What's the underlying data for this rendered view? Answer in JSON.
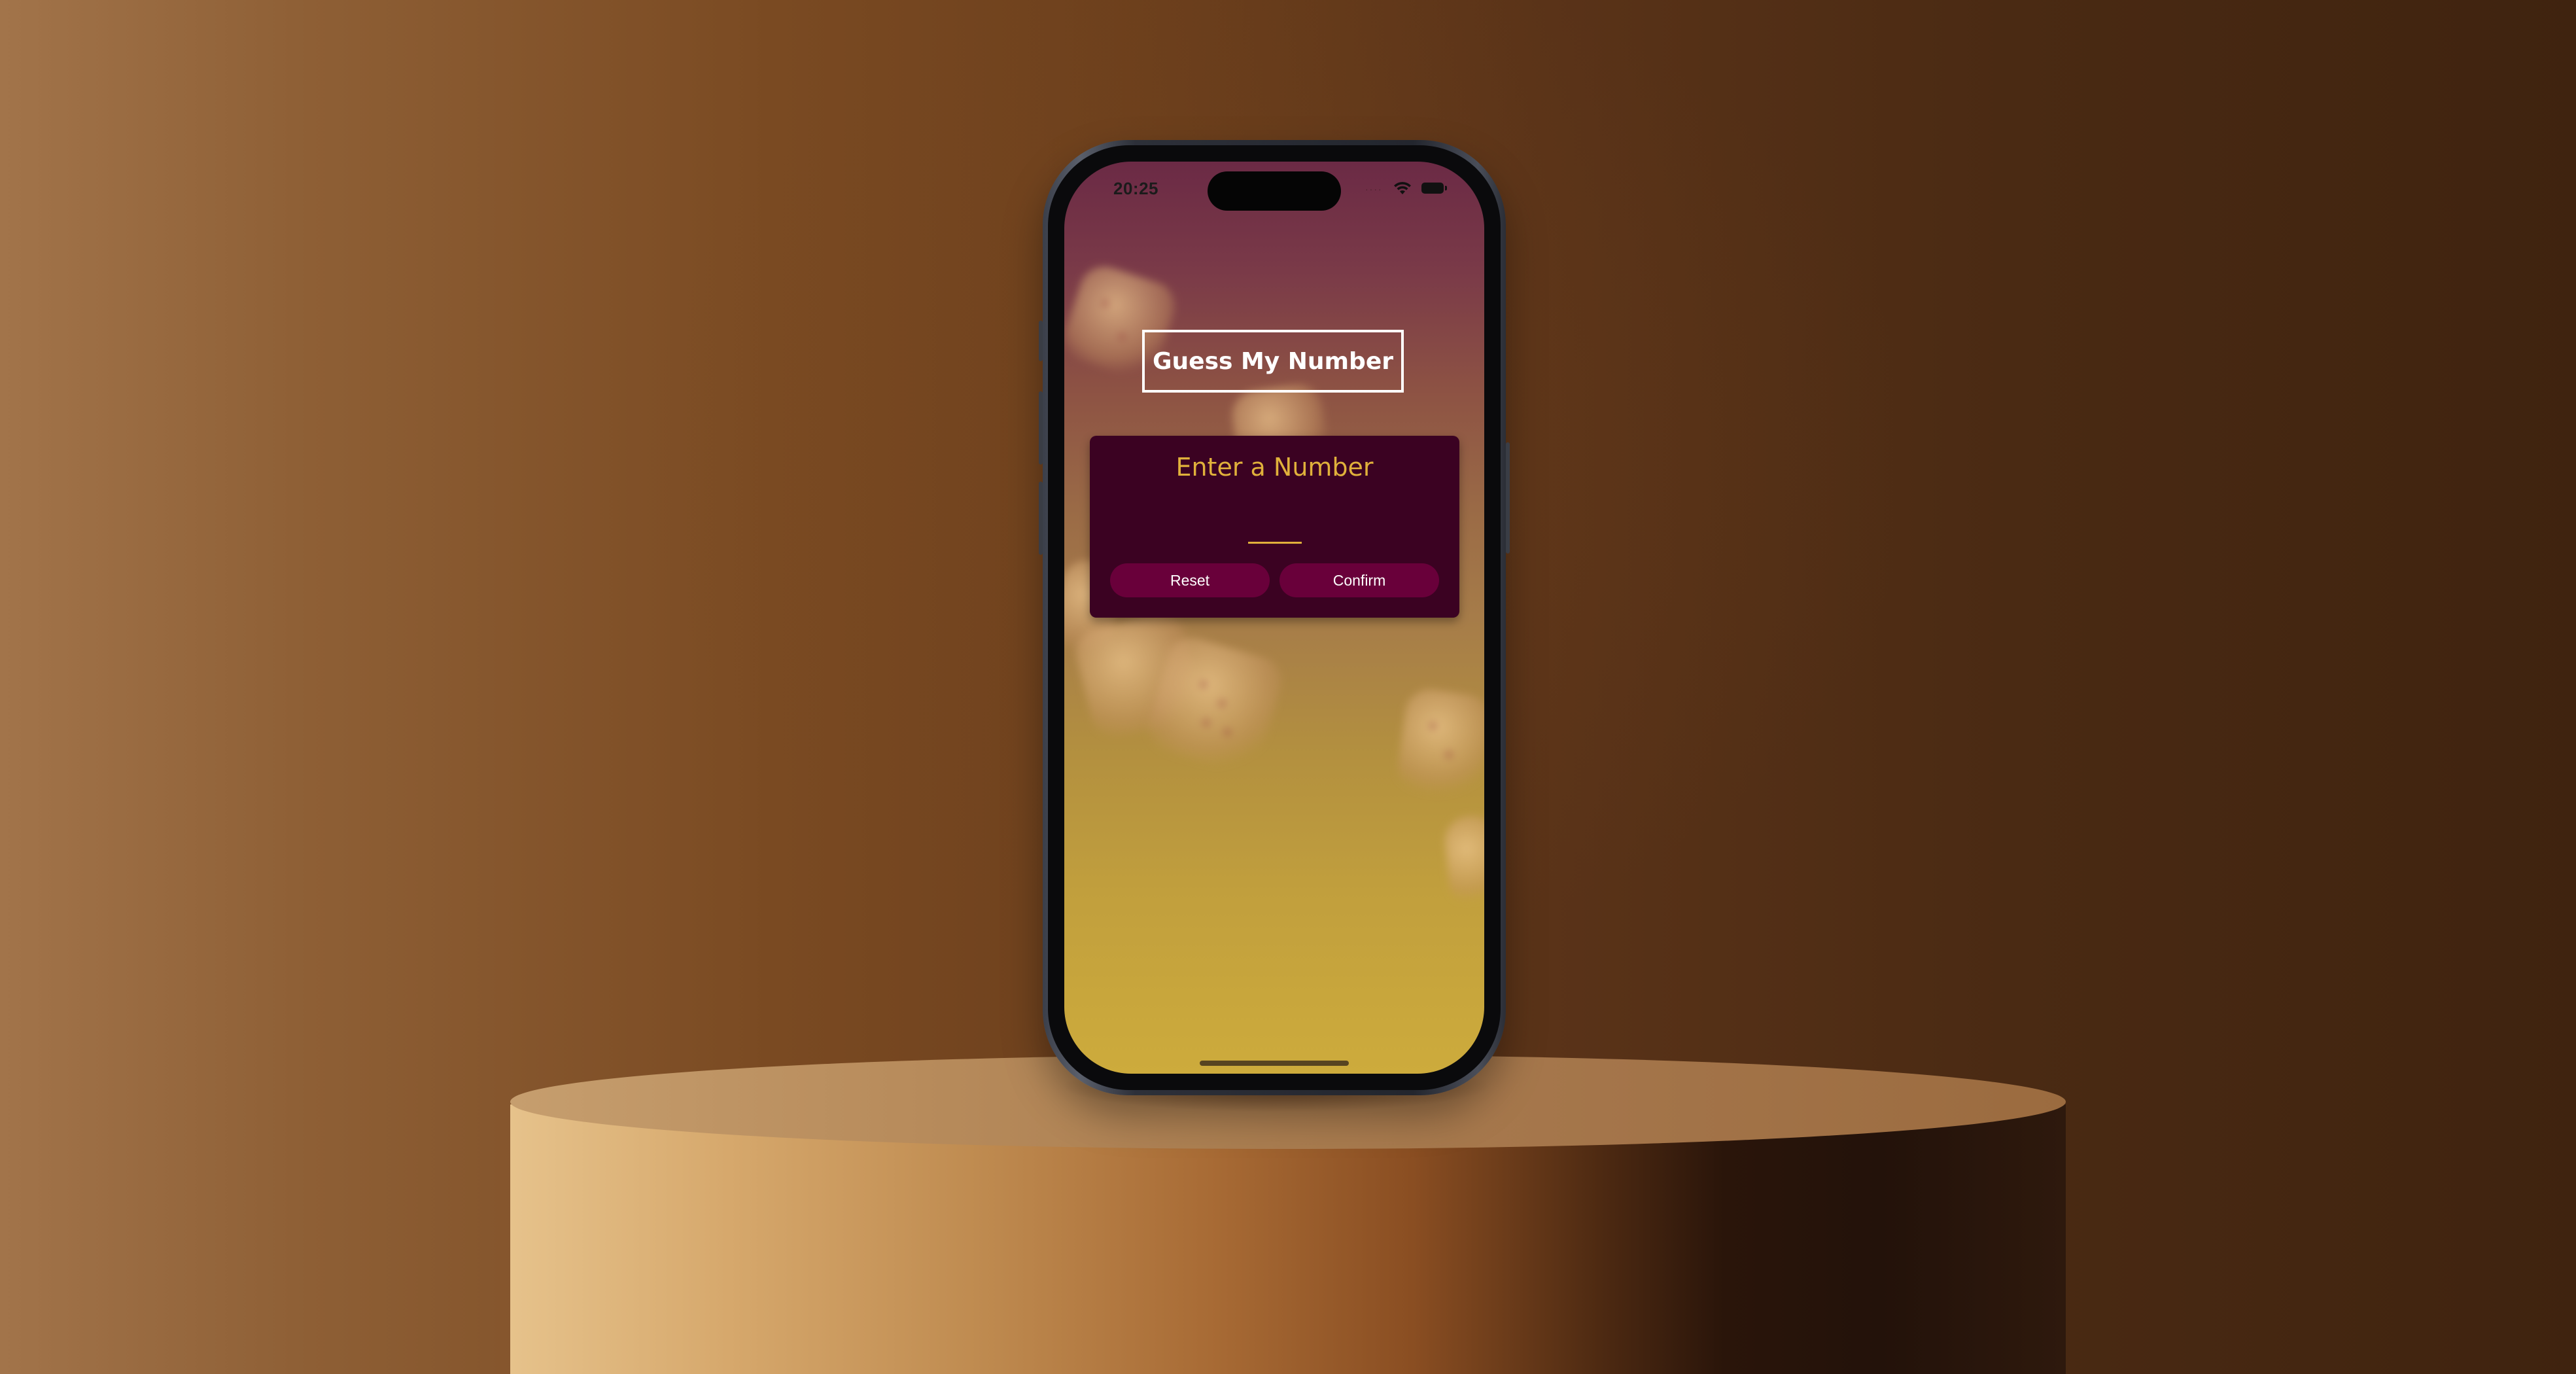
{
  "status_bar": {
    "time": "20:25",
    "wifi_icon": "wifi-icon",
    "battery_icon": "battery-icon"
  },
  "app": {
    "title": "Guess My Number",
    "card_heading": "Enter a Number",
    "number_input_value": "",
    "reset_label": "Reset",
    "confirm_label": "Confirm"
  },
  "colors": {
    "card_background": "#3b0222",
    "accent": "#e0b13b",
    "button_background": "#69003a",
    "gradient_top": "#6b2a45",
    "gradient_bottom": "#cdab3c"
  }
}
